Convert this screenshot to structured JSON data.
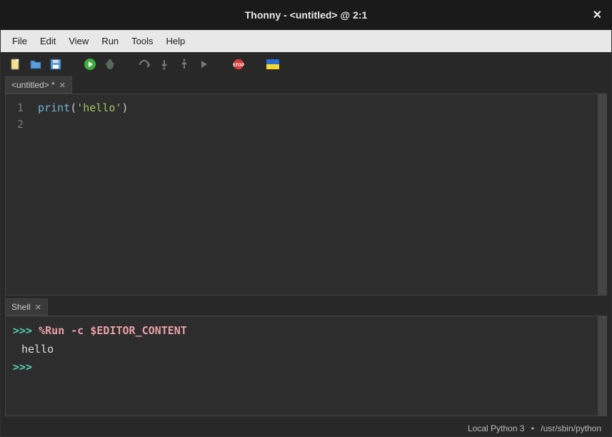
{
  "title": "Thonny  -  <untitled>  @  2:1",
  "menu": [
    "File",
    "Edit",
    "View",
    "Run",
    "Tools",
    "Help"
  ],
  "toolbar_icons": [
    "new-file-icon",
    "open-file-icon",
    "save-file-icon",
    "run-icon",
    "debug-icon",
    "step-over-icon",
    "step-into-icon",
    "step-out-icon",
    "resume-icon",
    "stop-icon",
    "flag-icon"
  ],
  "editor": {
    "tab_label": "<untitled> *",
    "lines": [
      1,
      2
    ],
    "code_tokens": [
      {
        "t": "print",
        "c": "fn"
      },
      {
        "t": "(",
        "c": ""
      },
      {
        "t": "'hello'",
        "c": "str"
      },
      {
        "t": ")",
        "c": ""
      }
    ]
  },
  "shell": {
    "tab_label": "Shell",
    "prompt": ">>>",
    "command": "%Run -c $EDITOR_CONTENT",
    "output": "hello"
  },
  "statusbar": {
    "interpreter": "Local Python 3",
    "path": "/usr/sbin/python"
  }
}
